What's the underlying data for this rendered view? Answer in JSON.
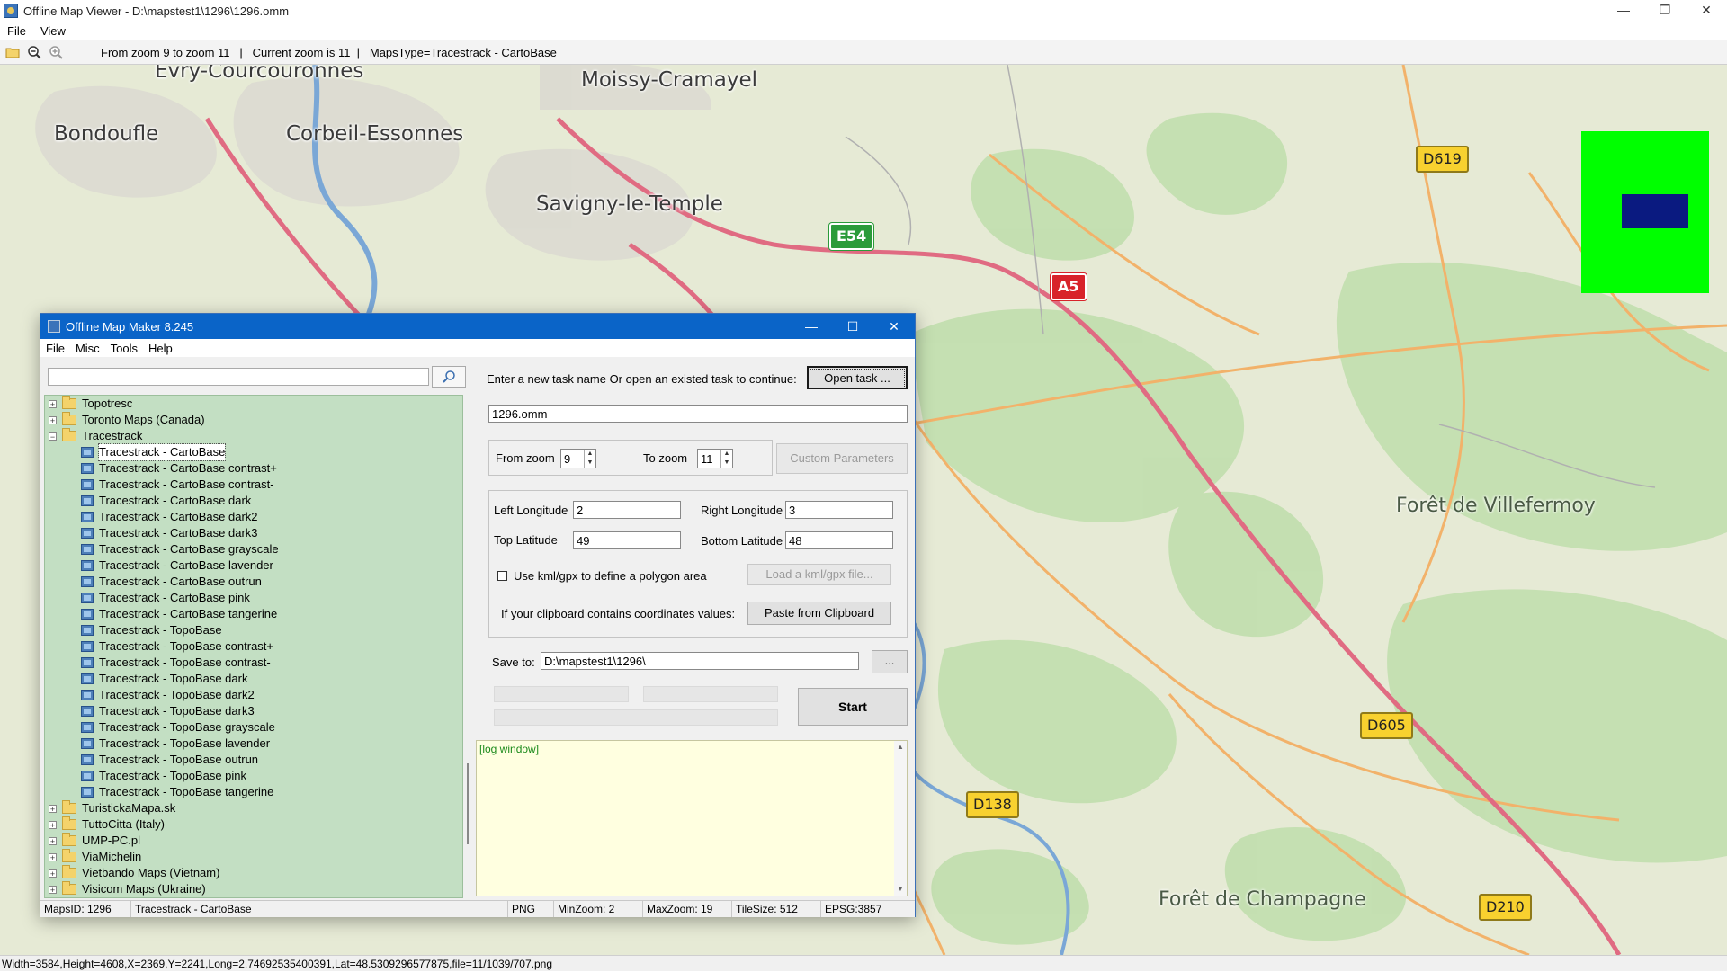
{
  "main": {
    "title": "Offline Map Viewer - D:\\mapstest1\\1296\\1296.omm",
    "menu": [
      "File",
      "View"
    ],
    "toolbar_status": "From zoom 9 to zoom 11   |   Current zoom is 11  |   MapsType=Tracestrack - CartoBase",
    "status": "Width=3584,Height=4608,X=2369,Y=2241,Long=2.74692535400391,Lat=48.5309296577875,file=11/1039/707.png",
    "controls": {
      "minimize": "—",
      "maximize": "❐",
      "close": "✕"
    }
  },
  "map": {
    "cities": [
      "Évry-Courcouronnes",
      "Moissy-Cramayel",
      "Bondoufle",
      "Corbeil-Essonnes",
      "Savigny-le-Temple"
    ],
    "forests": [
      "Forêt de Villefermoy",
      "Forêt de Champagne"
    ],
    "shields": [
      "D619",
      "E54",
      "A5",
      "D605",
      "D138",
      "D210"
    ],
    "colors": {
      "background": "#e6ead5",
      "forest": "#c3dfb0",
      "motorway": "#e06b82",
      "primary": "#f2b26a",
      "water": "#7aa7d6",
      "minimap": "#00ff00",
      "minimap_view": "#0a1a80"
    }
  },
  "dialog": {
    "title": "Offline Map Maker 8.245",
    "controls": {
      "minimize": "—",
      "maximize": "☐",
      "close": "✕"
    },
    "menu": [
      "File",
      "Misc",
      "Tools",
      "Help"
    ],
    "search_value": "",
    "tree": [
      {
        "label": "Topotresc",
        "kind": "folder",
        "expander": "+"
      },
      {
        "label": "Toronto Maps (Canada)",
        "kind": "folder",
        "expander": "+"
      },
      {
        "label": "Tracestrack",
        "kind": "folder",
        "expander": "−"
      },
      {
        "label": "Tracestrack - CartoBase",
        "kind": "map",
        "selected": true
      },
      {
        "label": "Tracestrack - CartoBase contrast+",
        "kind": "map"
      },
      {
        "label": "Tracestrack - CartoBase contrast-",
        "kind": "map"
      },
      {
        "label": "Tracestrack - CartoBase dark",
        "kind": "map"
      },
      {
        "label": "Tracestrack - CartoBase dark2",
        "kind": "map"
      },
      {
        "label": "Tracestrack - CartoBase dark3",
        "kind": "map"
      },
      {
        "label": "Tracestrack - CartoBase grayscale",
        "kind": "map"
      },
      {
        "label": "Tracestrack - CartoBase lavender",
        "kind": "map"
      },
      {
        "label": "Tracestrack - CartoBase outrun",
        "kind": "map"
      },
      {
        "label": "Tracestrack - CartoBase pink",
        "kind": "map"
      },
      {
        "label": "Tracestrack - CartoBase tangerine",
        "kind": "map"
      },
      {
        "label": "Tracestrack - TopoBase",
        "kind": "map"
      },
      {
        "label": "Tracestrack - TopoBase contrast+",
        "kind": "map"
      },
      {
        "label": "Tracestrack - TopoBase contrast-",
        "kind": "map"
      },
      {
        "label": "Tracestrack - TopoBase dark",
        "kind": "map"
      },
      {
        "label": "Tracestrack - TopoBase dark2",
        "kind": "map"
      },
      {
        "label": "Tracestrack - TopoBase dark3",
        "kind": "map"
      },
      {
        "label": "Tracestrack - TopoBase grayscale",
        "kind": "map"
      },
      {
        "label": "Tracestrack - TopoBase lavender",
        "kind": "map"
      },
      {
        "label": "Tracestrack - TopoBase outrun",
        "kind": "map"
      },
      {
        "label": "Tracestrack - TopoBase pink",
        "kind": "map"
      },
      {
        "label": "Tracestrack - TopoBase tangerine",
        "kind": "map"
      },
      {
        "label": "TuristickaMapa.sk",
        "kind": "folder",
        "expander": "+"
      },
      {
        "label": "TuttoCitta (Italy)",
        "kind": "folder",
        "expander": "+"
      },
      {
        "label": "UMP-PC.pl",
        "kind": "folder",
        "expander": "+"
      },
      {
        "label": "ViaMichelin",
        "kind": "folder",
        "expander": "+"
      },
      {
        "label": "Vietbando Maps (Vietnam)",
        "kind": "folder",
        "expander": "+"
      },
      {
        "label": "Visicom Maps (Ukraine)",
        "kind": "folder",
        "expander": "+"
      }
    ],
    "task_prompt": "Enter a new task name Or open an existed task to continue:",
    "open_task_label": "Open task ...",
    "task_name": "1296.omm",
    "from_zoom_label": "From zoom",
    "from_zoom": "9",
    "to_zoom_label": "To zoom",
    "to_zoom": "11",
    "custom_params_label": "Custom Parameters",
    "left_lon_label": "Left Longitude",
    "left_lon": "2",
    "right_lon_label": "Right Longitude",
    "right_lon": "3",
    "top_lat_label": "Top Latitude",
    "top_lat": "49",
    "bottom_lat_label": "Bottom Latitude",
    "bottom_lat": "48",
    "kml_check_label": "Use kml/gpx to define a polygon area",
    "load_kml_label": "Load a kml/gpx file...",
    "clipboard_prompt": "If your clipboard contains coordinates values:",
    "paste_label": "Paste from Clipboard",
    "save_to_label": "Save to:",
    "save_to": "D:\\mapstest1\\1296\\",
    "browse_label": "...",
    "start_label": "Start",
    "log_text": "[log window]",
    "status": [
      "MapsID: 1296",
      "Tracestrack - CartoBase",
      "PNG",
      "MinZoom: 2",
      "MaxZoom: 19",
      "TileSize: 512",
      "EPSG:3857"
    ]
  }
}
